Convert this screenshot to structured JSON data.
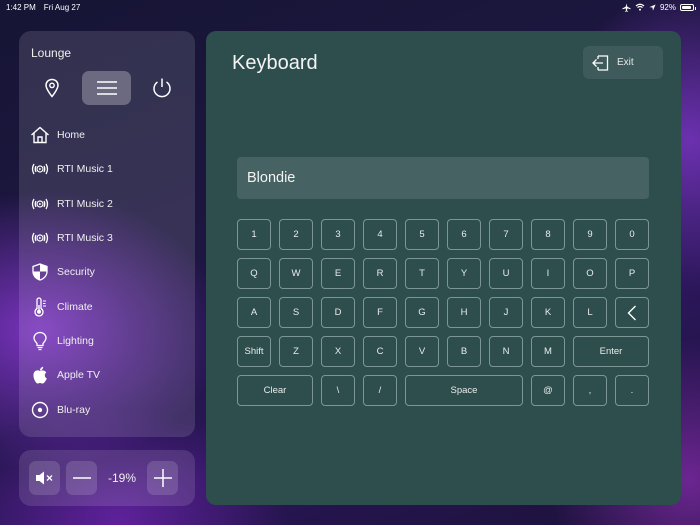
{
  "status_bar": {
    "time": "1:42 PM",
    "date": "Fri Aug 27",
    "battery": "92%",
    "battery_level": 0.92
  },
  "sidebar": {
    "zone": "Lounge",
    "modes": [
      {
        "icon": "location-pin-icon",
        "active": false
      },
      {
        "icon": "menu-icon",
        "active": true
      },
      {
        "icon": "power-icon",
        "active": false
      }
    ],
    "items": [
      {
        "label": "Home",
        "icon": "home-icon"
      },
      {
        "label": "RTI Music 1",
        "icon": "music-stream-icon"
      },
      {
        "label": "RTI Music 2",
        "icon": "music-stream-icon"
      },
      {
        "label": "RTI Music 3",
        "icon": "music-stream-icon"
      },
      {
        "label": "Security",
        "icon": "shield-icon"
      },
      {
        "label": "Climate",
        "icon": "thermometer-icon"
      },
      {
        "label": "Lighting",
        "icon": "bulb-icon"
      },
      {
        "label": "Apple TV",
        "icon": "apple-icon"
      },
      {
        "label": "Blu-ray",
        "icon": "disc-icon"
      }
    ]
  },
  "volume": {
    "value": "-19%"
  },
  "main": {
    "title": "Keyboard",
    "exit_label": "Exit",
    "input_value": "Blondie"
  },
  "keyboard": {
    "rows": [
      [
        "1",
        "2",
        "3",
        "4",
        "5",
        "6",
        "7",
        "8",
        "9",
        "0"
      ],
      [
        "Q",
        "W",
        "E",
        "R",
        "T",
        "Y",
        "U",
        "I",
        "O",
        "P"
      ],
      [
        "A",
        "S",
        "D",
        "F",
        "G",
        "H",
        "J",
        "K",
        "L",
        "backspace"
      ],
      [
        "Shift",
        "Z",
        "X",
        "C",
        "V",
        "B",
        "N",
        "M",
        "Enter"
      ],
      [
        "Clear",
        "\\",
        "/",
        "Space",
        "@",
        ",",
        "."
      ]
    ]
  }
}
